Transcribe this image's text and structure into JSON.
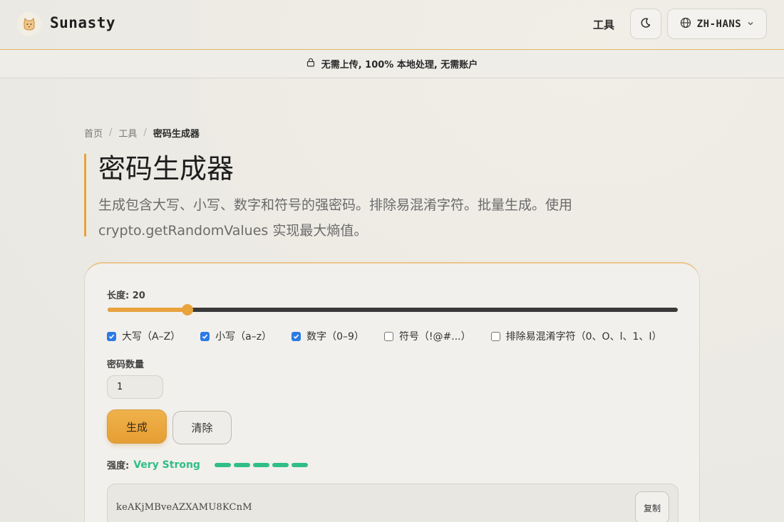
{
  "header": {
    "brand": "Sunasty",
    "nav_tools": "工具",
    "language": "ZH-HANS"
  },
  "banner": {
    "text": "无需上传, 100% 本地处理, 无需账户"
  },
  "breadcrumb": {
    "home": "首页",
    "tools": "工具",
    "current": "密码生成器"
  },
  "page": {
    "title": "密码生成器",
    "description": "生成包含大写、小写、数字和符号的强密码。排除易混淆字符。批量生成。使用 crypto.getRandomValues 实现最大熵值。"
  },
  "generator": {
    "length_label": "长度: 20",
    "length_fraction": 0.14,
    "options": [
      {
        "label": "大写（A–Z）",
        "checked": true
      },
      {
        "label": "小写（a–z）",
        "checked": true
      },
      {
        "label": "数字（0–9）",
        "checked": true
      },
      {
        "label": "符号（!@#...）",
        "checked": false
      },
      {
        "label": "排除易混淆字符（0、O、l、1、I）",
        "checked": false
      }
    ],
    "count_label": "密码数量",
    "count_value": "1",
    "generate_label": "生成",
    "clear_label": "清除",
    "strength_label": "强度:",
    "strength_value": "Very Strong",
    "strength_level": 5,
    "strength_max": 5,
    "password": "keAKjMBveAZXAMU8KCnM",
    "copy_label": "复制"
  },
  "colors": {
    "accent": "#E8A33D",
    "strength": "#2FBF86",
    "checkbox": "#2C7BE5"
  },
  "icons": {
    "logo": "cat-logo-icon",
    "theme": "moon-icon",
    "language": "globe-icon",
    "chevron": "chevron-down-icon",
    "lock": "lock-icon"
  }
}
